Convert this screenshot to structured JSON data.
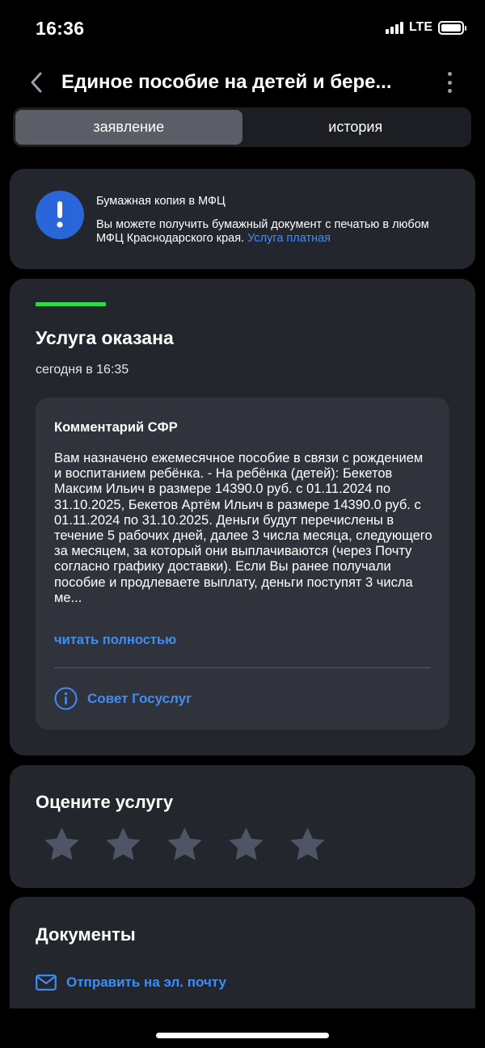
{
  "status_bar": {
    "time": "16:36",
    "network": "LTE"
  },
  "header": {
    "title": "Единое пособие на детей и бере..."
  },
  "tabs": [
    {
      "label": "заявление",
      "active": true
    },
    {
      "label": "история",
      "active": false
    }
  ],
  "info_card": {
    "icon": "exclamation-icon",
    "title": "Бумажная копия в МФЦ",
    "text": "Вы можете получить бумажный документ с печатью в любом МФЦ Краснодарского края.",
    "link_label": "Услуга платная"
  },
  "status_card": {
    "status_color": "#2bdb4a",
    "title": "Услуга оказана",
    "time": "сегодня в 16:35",
    "comment": {
      "title": "Комментарий СФР",
      "body": "Вам назначено ежемесячное пособие в связи с рождением и воспитанием ребёнка. - На ребёнка (детей): Бекетов Максим Ильич в размере 14390.0 руб. с 01.11.2024 по 31.10.2025, Бекетов Артём Ильич в размере 14390.0 руб. с 01.11.2024 по 31.10.2025. Деньги будут перечислены в течение 5 рабочих дней, далее 3 числа месяца, следующего за месяцем, за который они выплачиваются (через Почту согласно графику доставки). Если Вы ранее получали пособие и продлеваете выплату, деньги поступят 3 числа ме...",
      "read_more": "читать полностью",
      "advice_label": "Совет Госуслуг"
    }
  },
  "rating_card": {
    "title": "Оцените услугу",
    "stars_total": 5,
    "stars_selected": 0
  },
  "documents_card": {
    "title": "Документы",
    "send_email_label": "Отправить на эл. почту"
  },
  "colors": {
    "accent": "#3d8ef8",
    "card_bg": "#23262c",
    "info_icon_bg": "#2a65d9",
    "star_inactive": "#4f5565"
  }
}
